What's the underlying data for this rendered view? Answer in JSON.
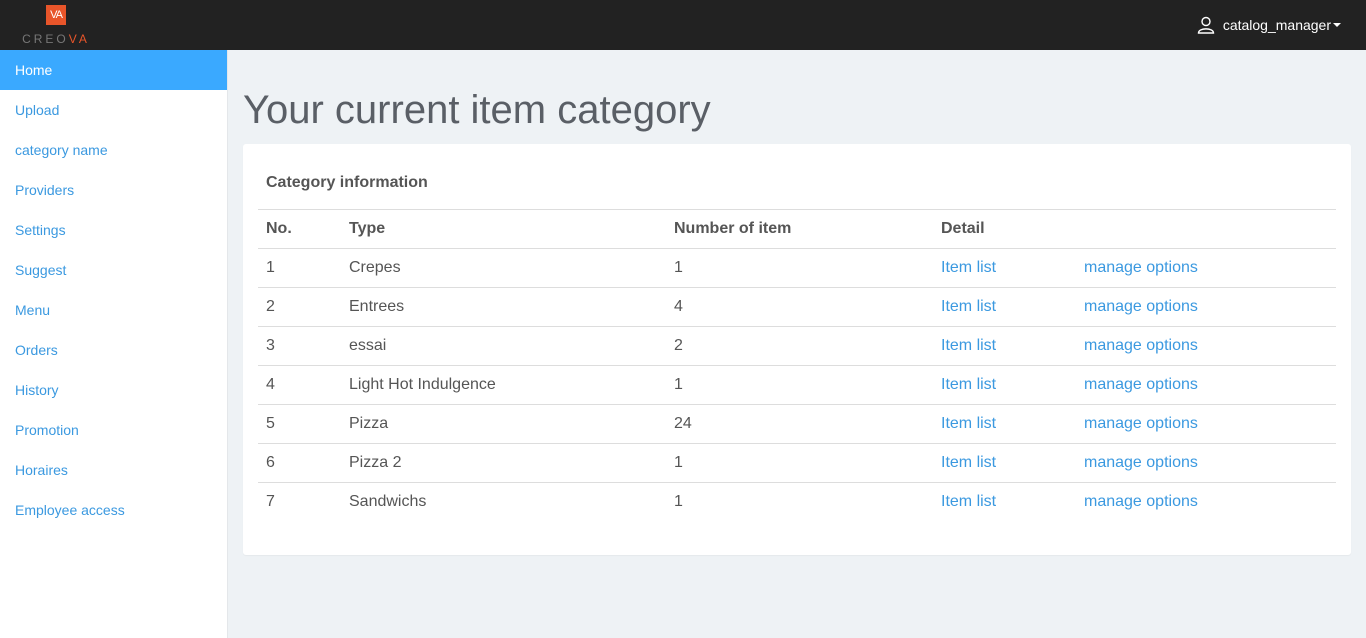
{
  "brand": {
    "mark": "VA",
    "name_start": "CREO",
    "name_accent": "VA"
  },
  "header": {
    "user_label": "catalog_manager"
  },
  "sidebar": {
    "items": [
      {
        "label": "Home",
        "active": true
      },
      {
        "label": "Upload"
      },
      {
        "label": "category name"
      },
      {
        "label": "Providers"
      },
      {
        "label": "Settings"
      },
      {
        "label": "Suggest"
      },
      {
        "label": "Menu"
      },
      {
        "label": "Orders"
      },
      {
        "label": "History"
      },
      {
        "label": "Promotion"
      },
      {
        "label": "Horaires"
      },
      {
        "label": "Employee access"
      }
    ]
  },
  "main": {
    "title": "Your current item category",
    "card_title": "Category information",
    "columns": [
      "No.",
      "Type",
      "Number of item",
      "Detail"
    ],
    "rows": [
      {
        "no": "1",
        "type": "Crepes",
        "count": "1",
        "link1": "Item list",
        "link2": "manage options"
      },
      {
        "no": "2",
        "type": "Entrees",
        "count": "4",
        "link1": "Item list",
        "link2": "manage options"
      },
      {
        "no": "3",
        "type": "essai",
        "count": "2",
        "link1": "Item list",
        "link2": "manage options"
      },
      {
        "no": "4",
        "type": "Light Hot Indulgence",
        "count": "1",
        "link1": "Item list",
        "link2": "manage options"
      },
      {
        "no": "5",
        "type": "Pizza",
        "count": "24",
        "link1": "Item list",
        "link2": "manage options"
      },
      {
        "no": "6",
        "type": "Pizza 2",
        "count": "1",
        "link1": "Item list",
        "link2": "manage options"
      },
      {
        "no": "7",
        "type": "Sandwichs",
        "count": "1",
        "link1": "Item list",
        "link2": "manage options"
      }
    ]
  },
  "colors": {
    "topbar": "#222222",
    "active_nav": "#3aa9ff",
    "link": "#3b99e0",
    "logo_accent": "#e8552a",
    "page_bg": "#eef2f5"
  },
  "icons": {
    "user": "user-icon",
    "dropdown": "caret-down-icon"
  }
}
